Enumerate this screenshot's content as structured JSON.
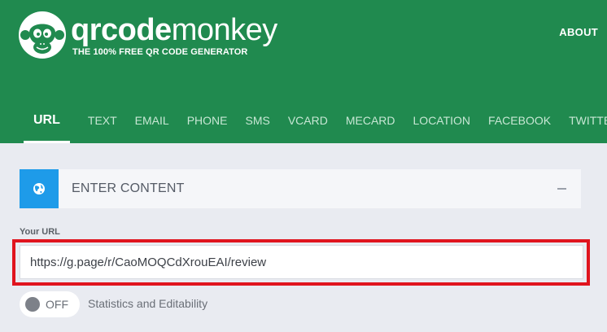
{
  "header": {
    "brand_bold": "qrcode",
    "brand_light": "monkey",
    "tagline": "THE 100% FREE QR CODE GENERATOR",
    "about_label": "ABOUT",
    "logo_icon": "monkey-face-icon"
  },
  "tabs": [
    {
      "label": "URL",
      "active": true
    },
    {
      "label": "TEXT"
    },
    {
      "label": "EMAIL"
    },
    {
      "label": "PHONE"
    },
    {
      "label": "SMS"
    },
    {
      "label": "VCARD"
    },
    {
      "label": "MECARD"
    },
    {
      "label": "LOCATION"
    },
    {
      "label": "FACEBOOK"
    },
    {
      "label": "TWITTER"
    }
  ],
  "content_panel": {
    "title": "ENTER CONTENT",
    "icon": "globe-icon",
    "collapse_icon": "minus-icon"
  },
  "url_field": {
    "label": "Your URL",
    "value": "https://g.page/r/CaoMOQCdXrouEAI/review"
  },
  "statistics": {
    "toggle_state": "OFF",
    "label": "Statistics and Editability"
  },
  "colors": {
    "header_green": "#208a4f",
    "accent_blue": "#1e9be9",
    "highlight_red": "#e0141e",
    "page_bg": "#e9ebf1"
  }
}
